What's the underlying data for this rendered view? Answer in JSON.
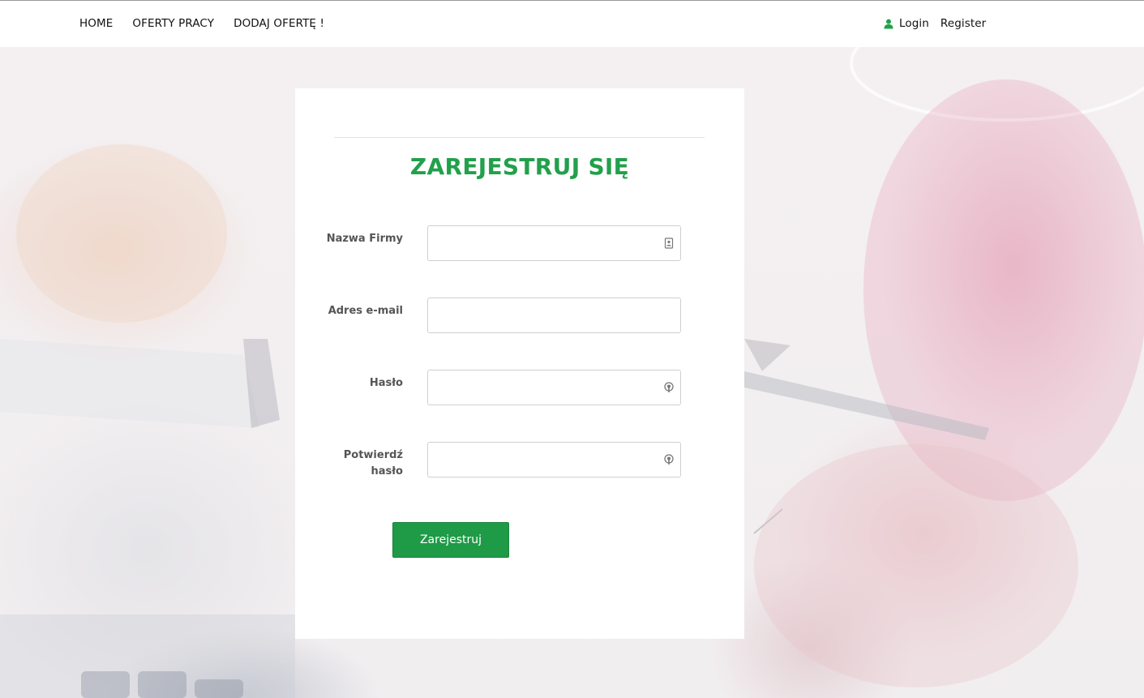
{
  "nav": {
    "home": "HOME",
    "jobs": "OFERTY PRACY",
    "add_offer": "DODAJ OFERTĘ !",
    "login": "Login",
    "register": "Register"
  },
  "form": {
    "title": "ZAREJESTRUJ SIĘ",
    "company_label": "Nazwa Firmy",
    "company_value": "",
    "email_label": "Adres e-mail",
    "email_value": "",
    "password_label": "Hasło",
    "password_value": "",
    "confirm_label_1": "Potwierdź",
    "confirm_label_2": "hasło",
    "confirm_value": "",
    "submit_label": "Zarejestruj"
  },
  "icons": {
    "user": "user-icon",
    "company_field": "contact-card-icon",
    "password_field": "key-icon",
    "confirm_field": "key-icon"
  },
  "colors": {
    "accent": "#22a04b",
    "button": "#1f9a47"
  }
}
